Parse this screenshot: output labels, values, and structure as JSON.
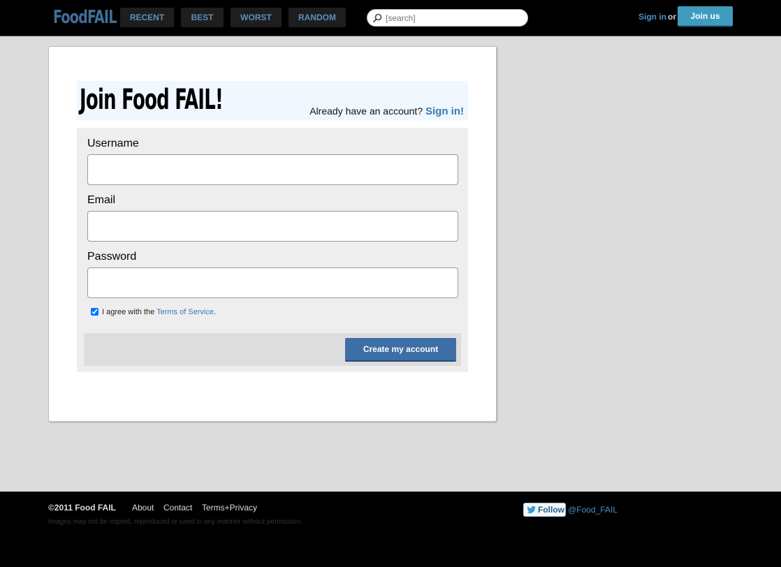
{
  "header": {
    "logo": "FoodFAIL",
    "nav": [
      "RECENT",
      "BEST",
      "WORST",
      "RANDOM"
    ],
    "search_placeholder": "[search]",
    "sign_in": "Sign in",
    "or": "or",
    "join": "Join us"
  },
  "signup": {
    "title": "Join Food FAIL!",
    "already_text": "Already have an account?",
    "already_link": "Sign in!",
    "username_label": "Username",
    "email_label": "Email",
    "password_label": "Password",
    "agree_text": "I agree with the",
    "terms_link": "Terms of Service",
    "agree_suffix": ".",
    "agree_checked": true,
    "submit": "Create my account"
  },
  "footer": {
    "copyright": "©2011 Food FAIL",
    "links": [
      "About",
      "Contact",
      "Terms+Privacy"
    ],
    "disclaimer": "Images may not be copied, reproduced or used in any manner without permission.",
    "follow": "Follow",
    "twitter_handle": "@Food_FAIL"
  },
  "colors": {
    "accent_blue": "#3a78b0",
    "join_button": "#3f9cbf",
    "submit_button": "#3d6fa6",
    "nav_text": "#5d8fbf"
  }
}
